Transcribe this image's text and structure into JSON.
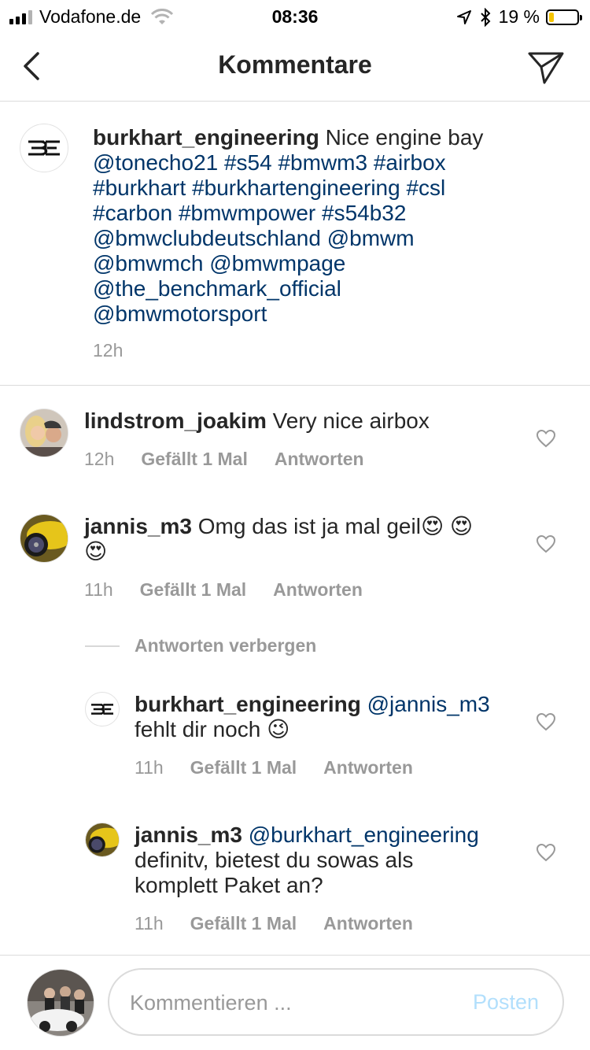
{
  "status_bar": {
    "carrier": "Vodafone.de",
    "time": "08:36",
    "battery_percent": "19 %",
    "battery_level": 0.19
  },
  "header": {
    "title": "Kommentare"
  },
  "caption": {
    "username": "burkhart_engineering",
    "text": "Nice engine bay",
    "tags": "@tonecho21 #s54 #bmwm3 #airbox #burkhart #burkhartengineering #csl #carbon #bmwmpower #s54b32 @bmwclubdeutschland @bmwm @bmwmch @bmwmpage @the_benchmark_official @bmwmotorsport",
    "tag_lines": [
      "@tonecho21 #s54 #bmwm3 #airbox",
      "#burkhart #burkhartengineering #csl",
      "#carbon #bmwmpower #s54b32",
      "@bmwclubdeutschland @bmwm",
      "@bmwmch @bmwmpage",
      "@the_benchmark_official",
      "@bmwmotorsport"
    ],
    "time": "12h",
    "logo_text": "BE"
  },
  "comments": [
    {
      "username": "lindstrom_joakim",
      "text": "Very nice airbox",
      "time": "12h",
      "likes": "Gefällt 1 Mal",
      "reply": "Antworten"
    },
    {
      "username": "jannis_m3",
      "text": "Omg das ist ja mal geil😍 😍",
      "text_line2": "😍",
      "time": "11h",
      "likes": "Gefällt 1 Mal",
      "reply": "Antworten"
    }
  ],
  "hide_replies": "Antworten verbergen",
  "replies": [
    {
      "username": "burkhart_engineering",
      "mention": "@jannis_m3",
      "text": "fehlt dir noch 😉",
      "time": "11h",
      "likes": "Gefällt 1 Mal",
      "reply": "Antworten"
    },
    {
      "username": "jannis_m3",
      "mention": "@burkhart_engineering",
      "text_line1": "definitv, bietest du sowas als",
      "text_line2": "komplett Paket an?",
      "time": "11h",
      "likes": "Gefällt 1 Mal",
      "reply": "Antworten"
    }
  ],
  "composer": {
    "placeholder": "Kommentieren ...",
    "post_label": "Posten"
  },
  "colors": {
    "link": "#003569",
    "meta": "#999999",
    "post_disabled": "#b2dffc",
    "battery": "#f5c400"
  }
}
